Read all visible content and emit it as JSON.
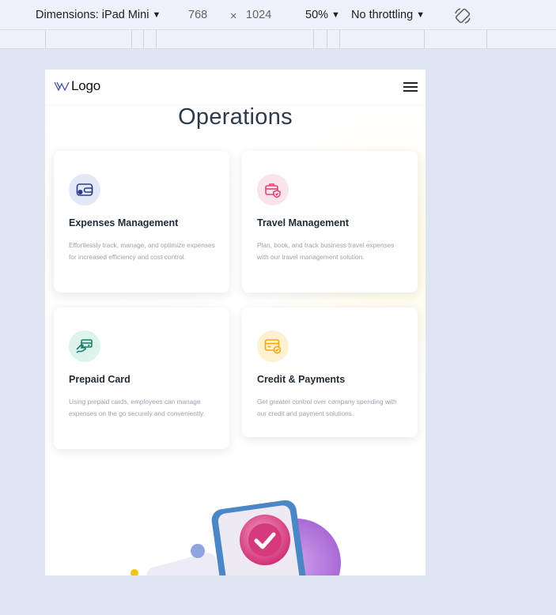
{
  "devtools": {
    "device_label": "Dimensions: iPad Mini",
    "width": "768",
    "times": "×",
    "height": "1024",
    "zoom": "50%",
    "throttling": "No throttling"
  },
  "page": {
    "logo_text": "Logo",
    "heading": "Operations",
    "cards": [
      {
        "title": "Expenses Management",
        "desc": "Effortlessly track, manage, and optimize expenses for increased efficiency and cost control.",
        "icon": "wallet-icon",
        "icon_bg": "#e3e8f7",
        "icon_color": "#2d3d8a"
      },
      {
        "title": "Travel Management",
        "desc": "Plan, book, and track business travel expenses with our travel management solution.",
        "icon": "briefcase-shield-icon",
        "icon_bg": "#fbe3ec",
        "icon_color": "#e0457a"
      },
      {
        "title": "Prepaid Card",
        "desc": "Using prepaid cards, employees can manage expenses on the go securely and conveniently.",
        "icon": "card-hand-icon",
        "icon_bg": "#ddf3ec",
        "icon_color": "#15806a"
      },
      {
        "title": "Credit & Payments",
        "desc": "Get greater control over company spending with our credit and payment solutions.",
        "icon": "credit-card-check-icon",
        "icon_bg": "#fdf1d2",
        "icon_color": "#f2a516"
      }
    ]
  }
}
